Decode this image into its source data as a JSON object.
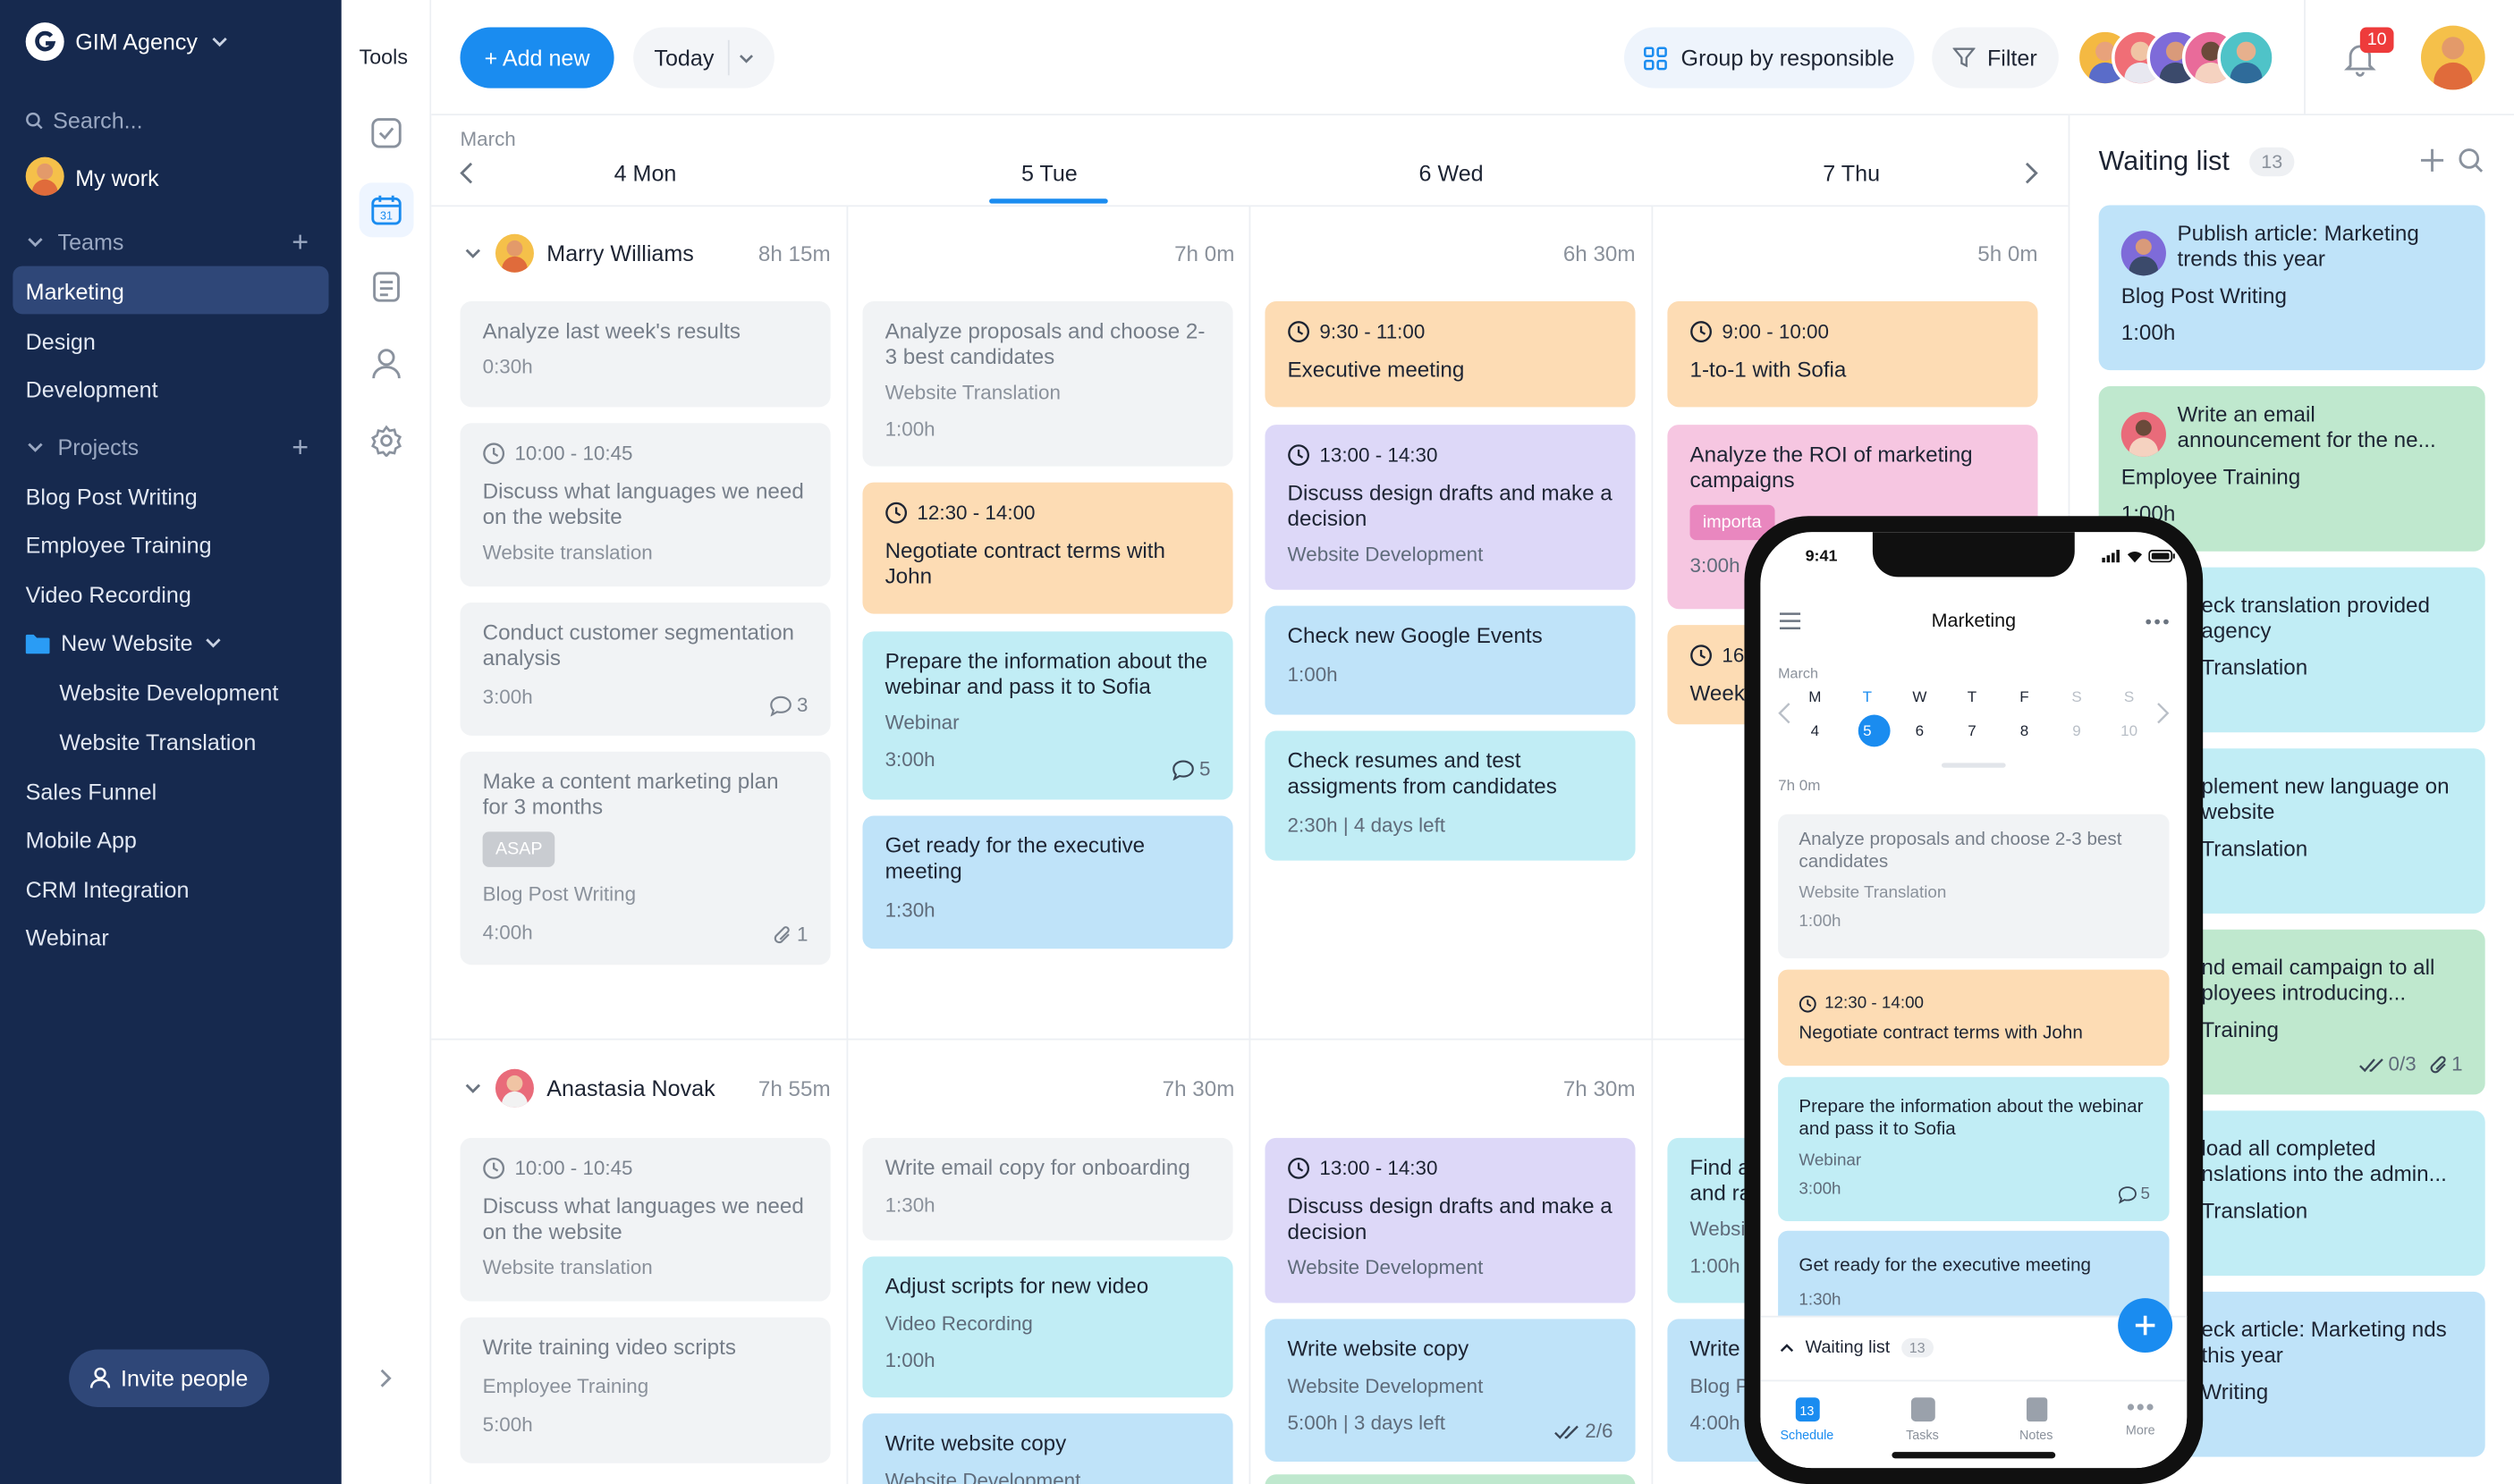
{
  "workspace": "GIM Agency",
  "search_placeholder": "Search...",
  "my_work": "My work",
  "teams_label": "Teams",
  "teams": [
    "Marketing",
    "Design",
    "Development"
  ],
  "projects_label": "Projects",
  "projects": [
    "Blog Post Writing",
    "Employee Training",
    "Video Recording"
  ],
  "folder": "New Website",
  "folder_items": [
    "Website Development",
    "Website Translation"
  ],
  "projects_more": [
    "Sales Funnel",
    "Mobile App",
    "CRM Integration",
    "Webinar"
  ],
  "invite": "Invite people",
  "tools_label": "Tools",
  "header": {
    "add_new": "+ Add new",
    "today": "Today",
    "group": "Group by responsible",
    "filter": "Filter",
    "notif_count": "10"
  },
  "calendar": {
    "month": "March",
    "days": [
      "4 Mon",
      "5 Tue",
      "6 Wed",
      "7 Thu"
    ]
  },
  "rows": [
    {
      "name": "Marry Williams",
      "totals": [
        "8h 15m",
        "7h 0m",
        "6h 30m",
        "5h 0m"
      ],
      "mon": [
        {
          "title": "Analyze last week's results",
          "dur": "0:30h"
        },
        {
          "time": "10:00 - 10:45",
          "title": "Discuss what languages we need on the website",
          "sub": "Website translation"
        },
        {
          "title": "Conduct customer segmentation analysis",
          "dur": "3:00h",
          "comments": "3"
        },
        {
          "title": "Make a content marketing plan for 3 months",
          "tag": "ASAP",
          "sub": "Blog Post Writing",
          "dur": "4:00h",
          "attach": "1"
        }
      ],
      "tue": [
        {
          "title": "Analyze proposals and choose 2-3 best candidates",
          "sub": "Website Translation",
          "dur": "1:00h"
        },
        {
          "time": "12:30 - 14:00",
          "title": "Negotiate contract terms with John"
        },
        {
          "title": "Prepare the information about the webinar and pass it to Sofia",
          "sub": "Webinar",
          "dur": "3:00h",
          "comments": "5"
        },
        {
          "title": "Get ready for the executive meeting",
          "dur": "1:30h"
        }
      ],
      "wed": [
        {
          "time": "9:30 - 11:00",
          "title": "Executive meeting"
        },
        {
          "time": "13:00 - 14:30",
          "title": "Discuss design drafts and make a decision",
          "sub": "Website Development"
        },
        {
          "title": "Check new Google Events",
          "dur": "1:00h"
        },
        {
          "title": "Check resumes and test assigments from candidates",
          "dur": "2:30h | 4 days left"
        }
      ],
      "thu": [
        {
          "time": "9:00 - 10:00",
          "title": "1-to-1 with Sofia"
        },
        {
          "title": "Analyze the ROI of marketing campaigns",
          "tag": "importa",
          "dur": "3:00h"
        },
        {
          "time": "16",
          "title": "Week"
        }
      ]
    },
    {
      "name": "Anastasia Novak",
      "totals": [
        "7h 55m",
        "7h 30m",
        "7h 30m",
        ""
      ],
      "mon": [
        {
          "time": "10:00 - 10:45",
          "title": "Discuss what languages we need on the website",
          "sub": "Website translation"
        },
        {
          "title": "Write training video scripts",
          "sub": "Employee Training",
          "dur": "5:00h"
        }
      ],
      "tue": [
        {
          "title": "Write email copy for onboarding",
          "dur": "1:30h"
        },
        {
          "title": "Adjust scripts for new video",
          "sub": "Video Recording",
          "dur": "1:00h"
        },
        {
          "title": "Write website copy",
          "sub": "Website Development"
        }
      ],
      "wed": [
        {
          "time": "13:00 - 14:30",
          "title": "Discuss design drafts and make a decision",
          "sub": "Website Development"
        },
        {
          "title": "Write website copy",
          "sub": "Website Development",
          "dur": "5:00h | 3 days left",
          "checks": "2/6"
        }
      ],
      "thu": [
        {
          "title": "Find a",
          "title2": "and ra",
          "sub": "Websi",
          "dur": "1:00h"
        },
        {
          "title": "Write",
          "sub": "Blog P",
          "dur": "4:00h"
        }
      ]
    }
  ],
  "waiting": {
    "title": "Waiting list",
    "count": "13",
    "items": [
      {
        "title": "Publish article: Marketing trends this year",
        "sub": "Blog Post Writing",
        "dur": "1:00h"
      },
      {
        "title": "Write an email announcement for the ne...",
        "sub": "Employee Training",
        "dur": "1:00h"
      },
      {
        "title": "eck translation provided agency",
        "sub": "Translation"
      },
      {
        "title": "plement new language on website",
        "sub": "Translation"
      },
      {
        "title": "nd email campaign to all ployees introducing...",
        "sub": "Training",
        "checks": "0/3",
        "attach": "1"
      },
      {
        "title": "load all completed nslations into the admin...",
        "sub": "Translation"
      },
      {
        "title": "eck article: Marketing nds this year",
        "sub": "Writing"
      }
    ]
  },
  "phone": {
    "time": "9:41",
    "title": "Marketing",
    "month": "March",
    "weekdays": [
      "M",
      "T",
      "W",
      "T",
      "F",
      "S",
      "S"
    ],
    "dates": [
      "4",
      "5",
      "6",
      "7",
      "8",
      "9",
      "10"
    ],
    "total": "7h 0m",
    "cards": [
      {
        "title": "Analyze proposals and choose 2-3 best candidates",
        "sub": "Website Translation",
        "dur": "1:00h"
      },
      {
        "time": "12:30 - 14:00",
        "title": "Negotiate contract terms with John"
      },
      {
        "title": "Prepare the information about the webinar and pass it to Sofia",
        "sub": "Webinar",
        "dur": "3:00h",
        "comments": "5"
      },
      {
        "title": "Get ready for the executive meeting",
        "dur": "1:30h"
      }
    ],
    "waiting": "Waiting list",
    "waiting_count": "13",
    "tabs": [
      "Schedule",
      "Tasks",
      "Notes",
      "More"
    ],
    "tab_badge": "13"
  },
  "colors": {
    "sidebar": "#16294e",
    "accent": "#1a8cf0",
    "active": "#2f4778"
  }
}
